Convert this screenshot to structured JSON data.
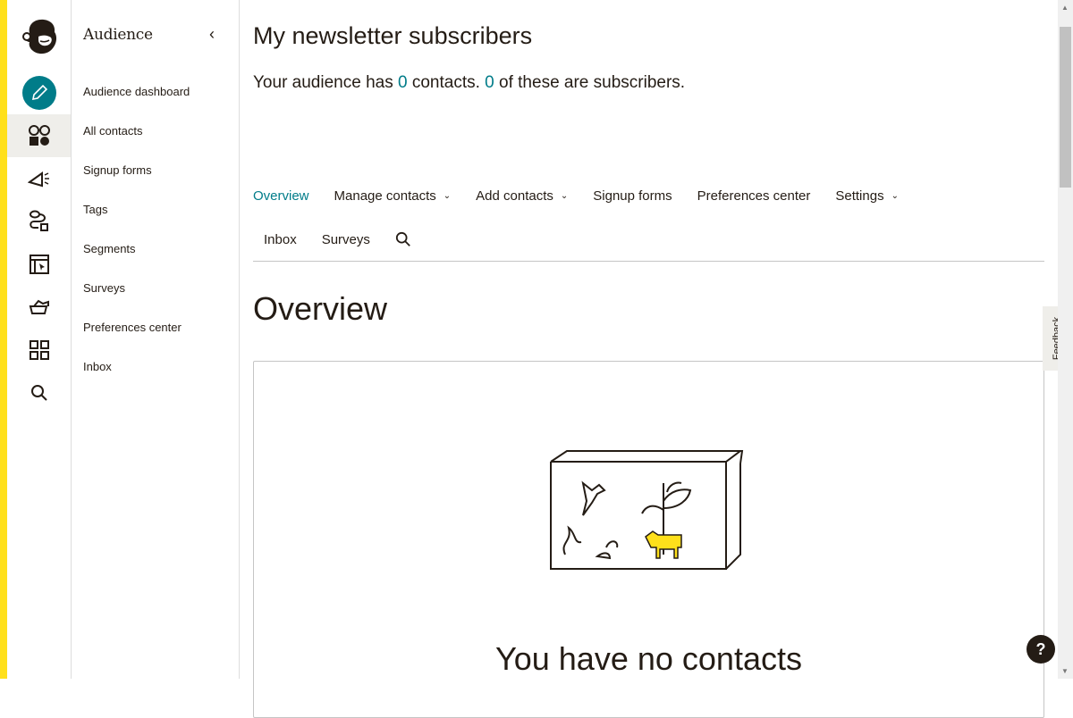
{
  "sidebar": {
    "title": "Audience",
    "items": [
      {
        "label": "Audience dashboard"
      },
      {
        "label": "All contacts"
      },
      {
        "label": "Signup forms"
      },
      {
        "label": "Tags"
      },
      {
        "label": "Segments"
      },
      {
        "label": "Surveys"
      },
      {
        "label": "Preferences center"
      },
      {
        "label": "Inbox"
      }
    ]
  },
  "rail": {
    "icons": [
      "mailchimp-logo",
      "create-pencil-icon",
      "audience-icon",
      "campaigns-icon",
      "automations-icon",
      "website-icon",
      "integrations-icon",
      "apps-grid-icon",
      "search-icon"
    ]
  },
  "header": {
    "title": "My newsletter subscribers",
    "summary_pre": "Your audience has ",
    "contacts": "0",
    "summary_mid": " contacts. ",
    "subscribers": "0",
    "summary_post": " of these are subscribers."
  },
  "tabs": [
    {
      "label": "Overview",
      "active": true
    },
    {
      "label": "Manage contacts",
      "dropdown": true
    },
    {
      "label": "Add contacts",
      "dropdown": true
    },
    {
      "label": "Signup forms"
    },
    {
      "label": "Preferences center"
    },
    {
      "label": "Settings",
      "dropdown": true
    },
    {
      "label": "Inbox"
    },
    {
      "label": "Surveys"
    }
  ],
  "section_title": "Overview",
  "empty_state": {
    "title": "You have no contacts"
  },
  "feedback": "Feedback",
  "help": "?",
  "colors": {
    "accent": "#007c89",
    "brand_yellow": "#ffe01b",
    "text": "#241c15"
  }
}
